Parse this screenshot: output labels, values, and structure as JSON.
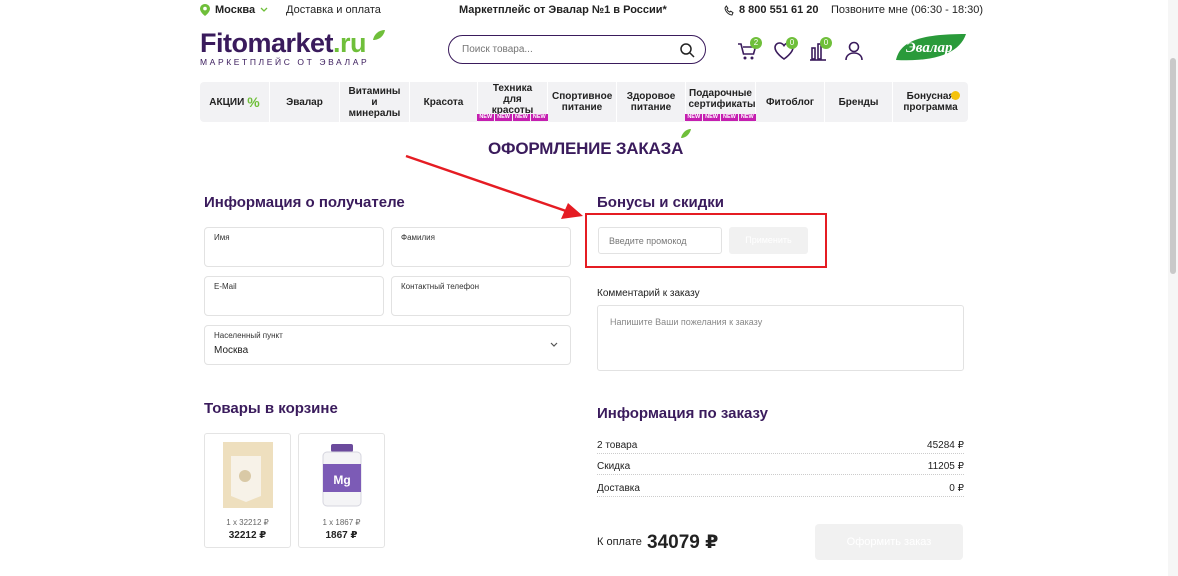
{
  "topbar": {
    "city": "Москва",
    "delivery": "Доставка и оплата",
    "promo": "Маркетплейс от Эвалар №1 в России*",
    "phone": "8 800 551 61 20",
    "callback": "Позвоните мне (06:30 - 18:30)"
  },
  "header": {
    "logo_main": "Fitomarket",
    "logo_ru": ".ru",
    "logo_sub": "МАРКЕТПЛЕЙС ОТ ЭВАЛАР",
    "search_placeholder": "Поиск товара...",
    "cart_badge": "2",
    "fav_badge": "0",
    "compare_badge": "0",
    "brand": "Эвалар"
  },
  "nav": {
    "items": [
      {
        "label": "АКЦИИ"
      },
      {
        "label": "Эвалар"
      },
      {
        "label": "Витамины и минералы"
      },
      {
        "label": "Красота"
      },
      {
        "label": "Техника для красоты"
      },
      {
        "label": "Спортивное питание"
      },
      {
        "label": "Здоровое питание"
      },
      {
        "label": "Подарочные сертификаты"
      },
      {
        "label": "Фитоблог"
      },
      {
        "label": "Бренды"
      },
      {
        "label": "Бонусная программа"
      }
    ],
    "percent": "%",
    "new_tag": "NEW"
  },
  "page_title": "ОФОРМЛЕНИЕ ЗАКАЗА",
  "recipient": {
    "title": "Информация о получателе",
    "first_name_label": "Имя",
    "last_name_label": "Фамилия",
    "email_label": "E-Mail",
    "phone_label": "Контактный телефон",
    "city_label": "Населенный пункт",
    "city_value": "Москва"
  },
  "bonus": {
    "title": "Бонусы и скидки",
    "promo_placeholder": "Введите промокод",
    "apply_button": "Применить"
  },
  "comment": {
    "label": "Комментарий к заказу",
    "placeholder": "Напишите Ваши пожелания к заказу"
  },
  "cart": {
    "title": "Товары в корзине",
    "items": [
      {
        "qty": "1 x 32212 ₽",
        "price": "32212 ₽"
      },
      {
        "qty": "1 x 1867 ₽",
        "price": "1867 ₽"
      }
    ]
  },
  "order_info": {
    "title": "Информация по заказу",
    "rows": [
      {
        "label": "2 товара",
        "value": "45284 ₽"
      },
      {
        "label": "Скидка",
        "value": "11205 ₽"
      },
      {
        "label": "Доставка",
        "value": "0 ₽"
      }
    ],
    "total_label": "К оплате",
    "total_value": "34079 ₽",
    "submit_button": "Оформить заказ"
  },
  "colors": {
    "brand_purple": "#3a1b5c",
    "brand_green": "#6fbf3a",
    "annotation_red": "#e51c23",
    "new_tag": "#c51fb0"
  }
}
